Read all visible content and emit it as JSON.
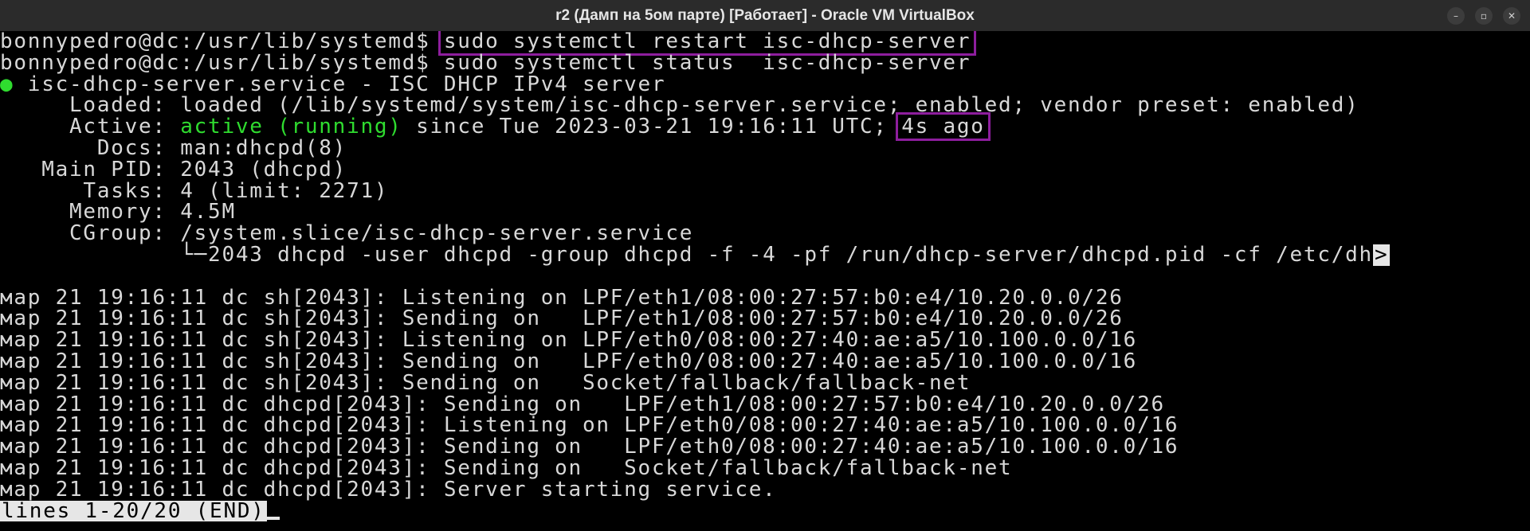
{
  "window": {
    "title": "r2 (Дамп на 5ом парте) [Работает] - Oracle VM VirtualBox",
    "controls": {
      "minimize": "–",
      "restore": "▫",
      "close": "✕"
    }
  },
  "terminal": {
    "prompt1": "bonnypedro@dc:/usr/lib/systemd$ ",
    "cmd1": "sudo systemctl restart isc-dhcp-server",
    "prompt2": "bonnypedro@dc:/usr/lib/systemd$ ",
    "cmd2": "sudo systemctl status  isc-dhcp-server",
    "service_dot": "●",
    "service_line": " isc-dhcp-server.service - ISC DHCP IPv4 server",
    "loaded": "     Loaded: loaded (/lib/systemd/system/isc-dhcp-server.service; enabled; vendor preset: enabled)",
    "active_label": "     Active: ",
    "active_state": "active (running)",
    "active_since": " since Tue 2023-03-21 19:16:11 UTC; ",
    "active_ago": "4s ago",
    "docs": "       Docs: man:dhcpd(8)",
    "main_pid": "   Main PID: 2043 (dhcpd)",
    "tasks": "      Tasks: 4 (limit: 2271)",
    "memory": "     Memory: 4.5M",
    "cgroup": "     CGroup: /system.slice/isc-dhcp-server.service",
    "cgroup_child": "             └─2043 dhcpd -user dhcpd -group dhcpd -f -4 -pf /run/dhcp-server/dhcpd.pid -cf /etc/dh",
    "truncate_marker": ">",
    "logs": [
      "мар 21 19:16:11 dc sh[2043]: Listening on LPF/eth1/08:00:27:57:b0:e4/10.20.0.0/26",
      "мар 21 19:16:11 dc sh[2043]: Sending on   LPF/eth1/08:00:27:57:b0:e4/10.20.0.0/26",
      "мар 21 19:16:11 dc sh[2043]: Listening on LPF/eth0/08:00:27:40:ae:a5/10.100.0.0/16",
      "мар 21 19:16:11 dc sh[2043]: Sending on   LPF/eth0/08:00:27:40:ae:a5/10.100.0.0/16",
      "мар 21 19:16:11 dc sh[2043]: Sending on   Socket/fallback/fallback-net",
      "мар 21 19:16:11 dc dhcpd[2043]: Sending on   LPF/eth1/08:00:27:57:b0:e4/10.20.0.0/26",
      "мар 21 19:16:11 dc dhcpd[2043]: Listening on LPF/eth0/08:00:27:40:ae:a5/10.100.0.0/16",
      "мар 21 19:16:11 dc dhcpd[2043]: Sending on   LPF/eth0/08:00:27:40:ae:a5/10.100.0.0/16",
      "мар 21 19:16:11 dc dhcpd[2043]: Sending on   Socket/fallback/fallback-net",
      "мар 21 19:16:11 dc dhcpd[2043]: Server starting service."
    ],
    "pager_status": "lines 1-20/20 (END)"
  }
}
